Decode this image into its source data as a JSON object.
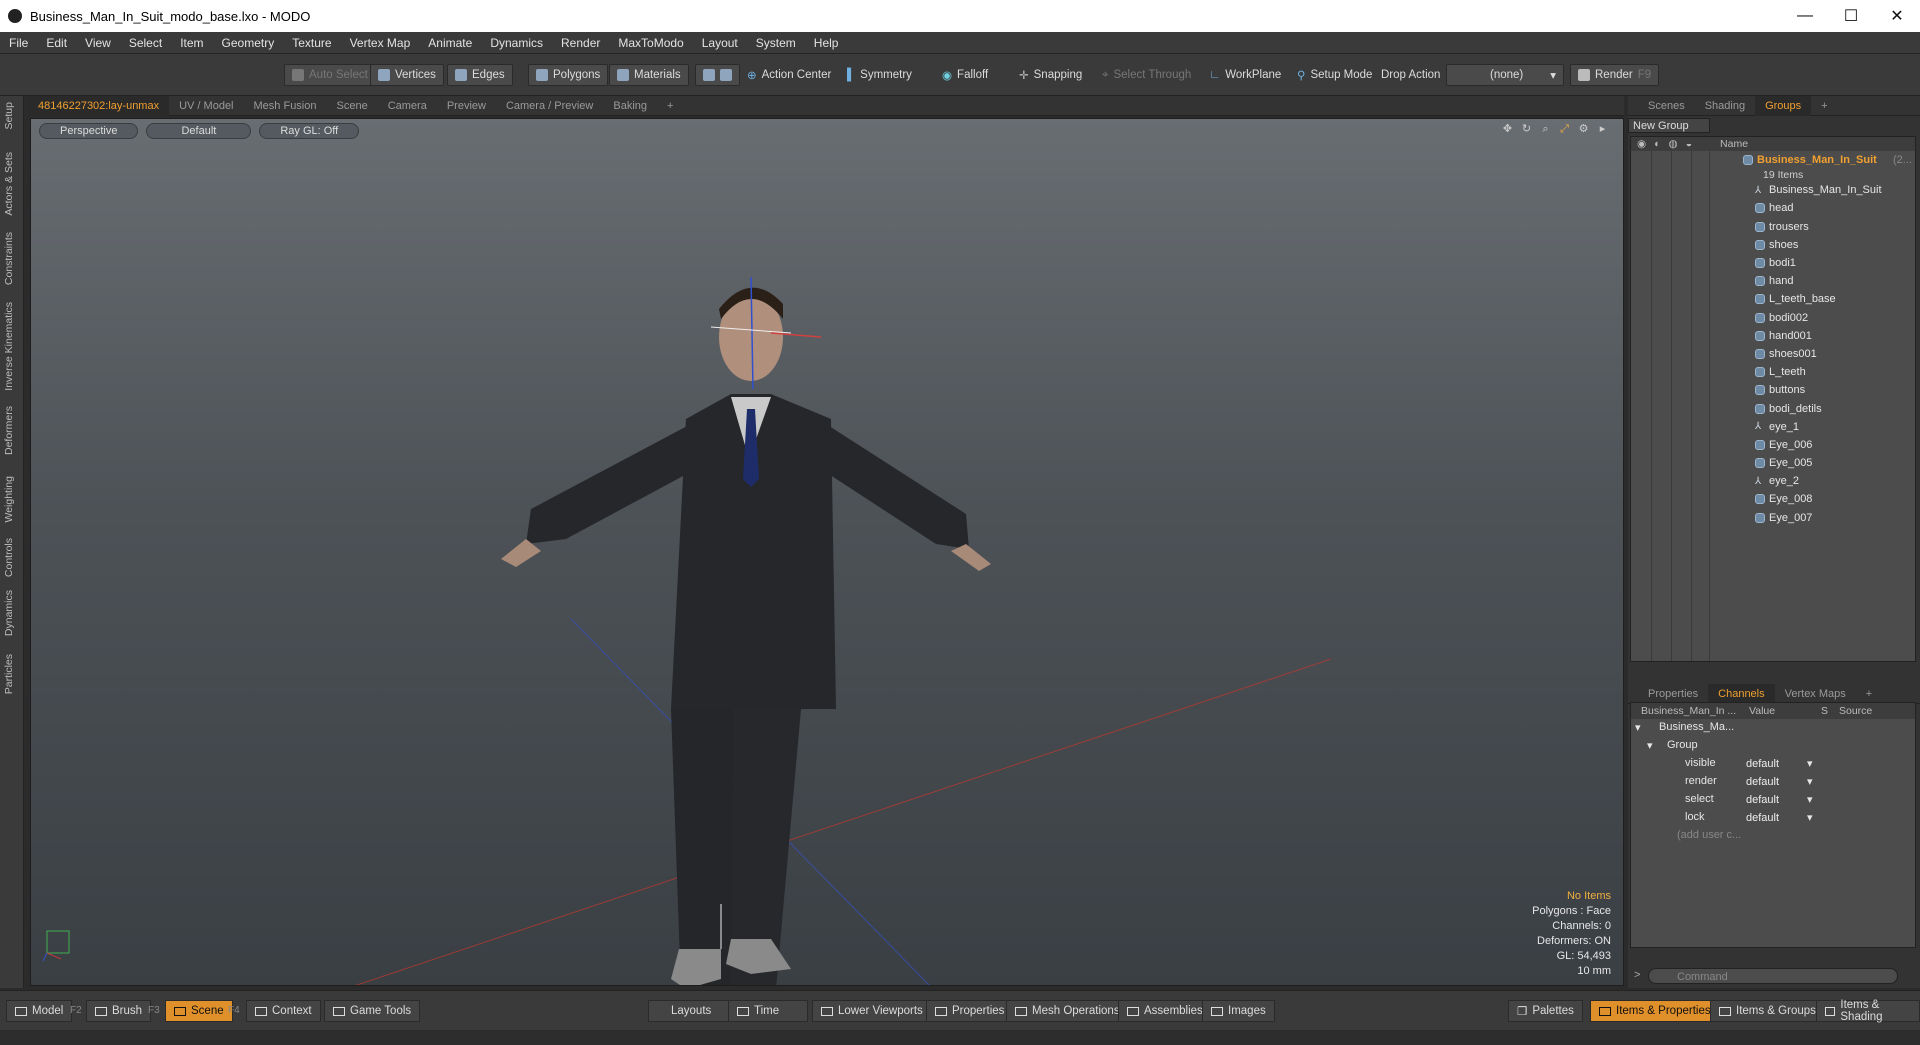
{
  "window": {
    "title": "Business_Man_In_Suit_modo_base.lxo - MODO",
    "min": "—",
    "max": "☐",
    "close": "✕"
  },
  "menu": [
    "File",
    "Edit",
    "View",
    "Select",
    "Item",
    "Geometry",
    "Texture",
    "Vertex Map",
    "Animate",
    "Dynamics",
    "Render",
    "MaxToModo",
    "Layout",
    "System",
    "Help"
  ],
  "toolbar": {
    "auto_select": "Auto Select",
    "vertices": "Vertices",
    "edges": "Edges",
    "polygons": "Polygons",
    "materials": "Materials",
    "action_center": "Action Center",
    "symmetry": "Symmetry",
    "falloff": "Falloff",
    "snapping": "Snapping",
    "select_through": "Select Through",
    "workplane": "WorkPlane",
    "setup_mode": "Setup Mode",
    "drop_action": "Drop Action",
    "drop_value": "(none)",
    "render": "Render",
    "render_key": "F9"
  },
  "left_tabs": [
    "Setup",
    "Actors & Sets",
    "Constraints",
    "Inverse Kinematics",
    "Deformers",
    "Weighting",
    "Controls",
    "Dynamics",
    "Particles"
  ],
  "viewport_tabs": [
    "48146227302:lay-unmax",
    "UV / Model",
    "Mesh Fusion",
    "Scene",
    "Camera",
    "Preview",
    "Camera / Preview",
    "Baking",
    "+"
  ],
  "viewport": {
    "perspective": "Perspective",
    "default": "Default",
    "raygl": "Ray GL: Off",
    "stats": {
      "items": "No Items",
      "polygons": "Polygons : Face",
      "channels": "Channels: 0",
      "deformers": "Deformers: ON",
      "gl": "GL: 54,493",
      "scale": "10 mm"
    }
  },
  "right_tabs": [
    "Scenes",
    "Shading",
    "Groups",
    "+"
  ],
  "groups": {
    "new_group": "New Group",
    "name_header": "Name",
    "root": "Business_Man_In_Suit",
    "root_suffix": "(2...",
    "count": "19 Items",
    "items": [
      {
        "name": "Business_Man_In_Suit",
        "icon": "locator-icon"
      },
      {
        "name": "head",
        "icon": "mesh-icon"
      },
      {
        "name": "trousers",
        "icon": "mesh-icon"
      },
      {
        "name": "shoes",
        "icon": "mesh-icon"
      },
      {
        "name": "bodi1",
        "icon": "mesh-icon"
      },
      {
        "name": "hand",
        "icon": "mesh-icon"
      },
      {
        "name": "L_teeth_base",
        "icon": "mesh-icon"
      },
      {
        "name": "bodi002",
        "icon": "mesh-icon"
      },
      {
        "name": "hand001",
        "icon": "mesh-icon"
      },
      {
        "name": "shoes001",
        "icon": "mesh-icon"
      },
      {
        "name": "L_teeth",
        "icon": "mesh-icon"
      },
      {
        "name": "buttons",
        "icon": "mesh-icon"
      },
      {
        "name": "bodi_detils",
        "icon": "mesh-icon"
      },
      {
        "name": "eye_1",
        "icon": "locator-icon"
      },
      {
        "name": "Eye_006",
        "icon": "mesh-icon"
      },
      {
        "name": "Eye_005",
        "icon": "mesh-icon"
      },
      {
        "name": "eye_2",
        "icon": "locator-icon"
      },
      {
        "name": "Eye_008",
        "icon": "mesh-icon"
      },
      {
        "name": "Eye_007",
        "icon": "mesh-icon"
      }
    ]
  },
  "prop_tabs": [
    "Properties",
    "Channels",
    "Vertex Maps",
    "+"
  ],
  "channels": {
    "headers": [
      "Business_Man_In ...",
      "Value",
      "S",
      "Source"
    ],
    "item": "Business_Ma...",
    "group": "Group",
    "rows": [
      {
        "name": "visible",
        "value": "default"
      },
      {
        "name": "render",
        "value": "default"
      },
      {
        "name": "select",
        "value": "default"
      },
      {
        "name": "lock",
        "value": "default"
      }
    ],
    "add_user": "(add user c..."
  },
  "command_placeholder": "Command",
  "bottom": {
    "model": "Model",
    "model_key": "F2",
    "brush": "Brush",
    "brush_key": "F3",
    "scene": "Scene",
    "scene_key": "F4",
    "context": "Context",
    "game_tools": "Game Tools",
    "layouts": "Layouts",
    "time": "Time",
    "lower_viewports": "Lower Viewports",
    "properties": "Properties",
    "mesh_operations": "Mesh Operations",
    "assemblies": "Assemblies",
    "images": "Images",
    "palettes": "Palettes",
    "items_properties": "Items & Properties",
    "items_groups": "Items & Groups",
    "items_shading": "Items & Shading"
  },
  "colors": {
    "accent": "#f0a030",
    "viewport_top": "#686d72",
    "viewport_bottom": "#3a3f44",
    "panel": "#4c4c4c"
  }
}
